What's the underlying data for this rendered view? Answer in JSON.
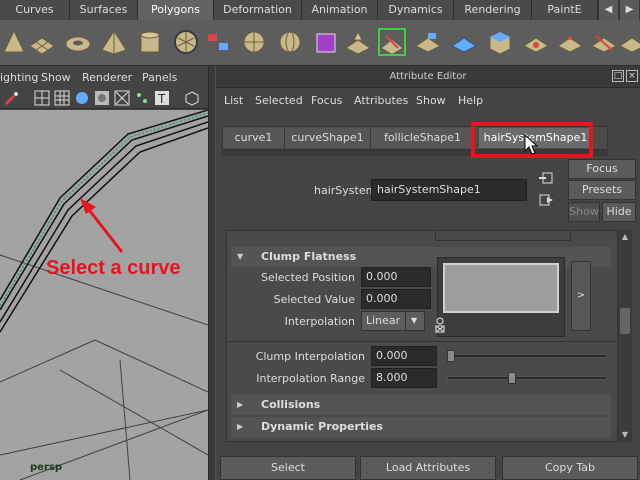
{
  "shelf": {
    "tabs": [
      "Curves",
      "Surfaces",
      "Polygons",
      "Deformation",
      "Animation",
      "Dynamics",
      "Rendering",
      "PaintE"
    ],
    "active_tab": "Polygons"
  },
  "viewport": {
    "menus": [
      "ighting",
      "Show",
      "Renderer",
      "Panels"
    ],
    "camera_label": "persp",
    "annotation_text": "Select a curve"
  },
  "attribute_editor": {
    "title": "Attribute Editor",
    "menus": [
      "List",
      "Selected",
      "Focus",
      "Attributes",
      "Show",
      "Help"
    ],
    "tabs": [
      "curve1",
      "curveShape1",
      "follicleShape1",
      "hairSystemShape1"
    ],
    "active_tab": "hairSystemShape1",
    "node_label": "hairSystem:",
    "node_value": "hairSystemShape1",
    "buttons": {
      "focus": "Focus",
      "presets": "Presets",
      "show": "Show",
      "hide": "Hide"
    },
    "sections": {
      "clump_flatness": {
        "title": "Clump Flatness",
        "selected_position_label": "Selected Position",
        "selected_position_value": "0.000",
        "selected_value_label": "Selected Value",
        "selected_value_value": "0.000",
        "interpolation_label": "Interpolation",
        "interpolation_value": "Linear",
        "ramp_expand": ">"
      },
      "clump_interpolation_label": "Clump Interpolation",
      "clump_interpolation_value": "0.000",
      "clump_interpolation_slider": 0.0,
      "interpolation_range_label": "Interpolation Range",
      "interpolation_range_value": "8.000",
      "interpolation_range_slider": 0.4,
      "collisions": "Collisions",
      "dynamic_properties": "Dynamic Properties"
    },
    "bottom_buttons": {
      "select": "Select",
      "load_attributes": "Load Attributes",
      "copy_tab": "Copy Tab"
    }
  },
  "colors": {
    "annotation": "#e6141e",
    "panel_bg": "#444444",
    "viewport_bg": "#a3a3a3"
  }
}
